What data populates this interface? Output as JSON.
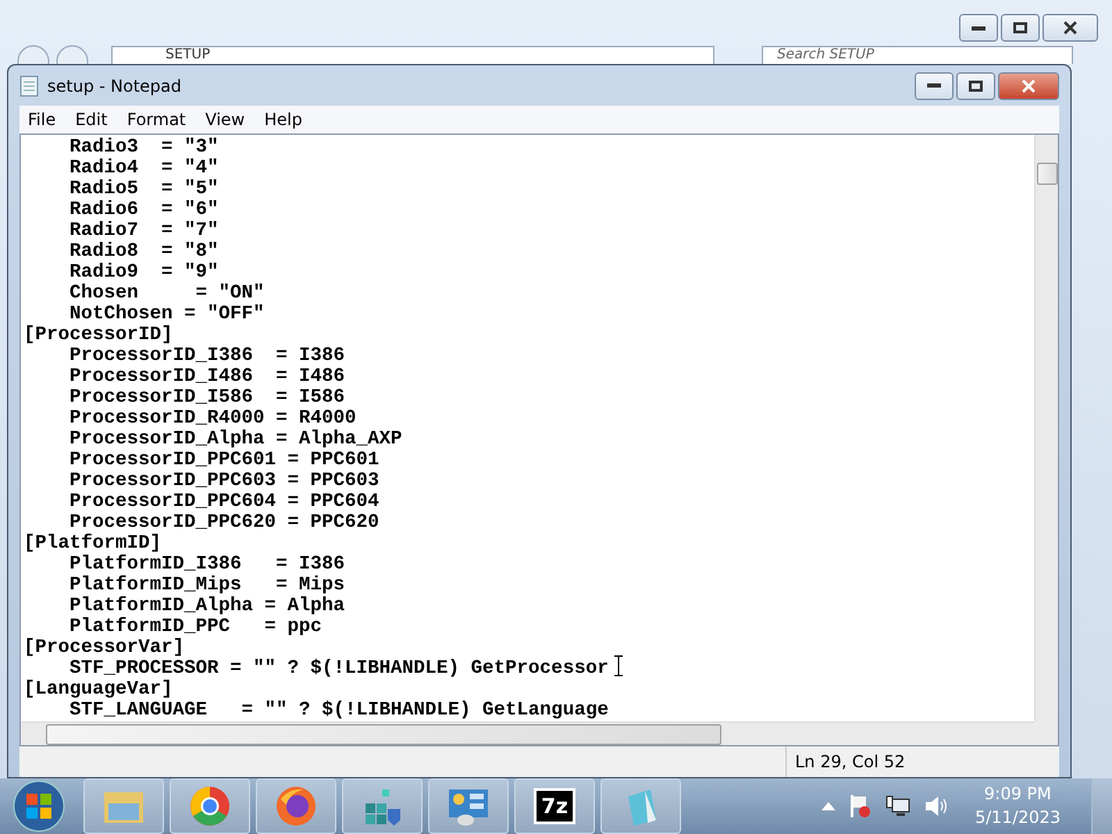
{
  "background_window": {
    "address": "SETUP",
    "search_placeholder": "Search SETUP"
  },
  "window": {
    "title": "setup - Notepad"
  },
  "menu": [
    "File",
    "Edit",
    "Format",
    "View",
    "Help"
  ],
  "lines": [
    "    Radio3  = \"3\"",
    "    Radio4  = \"4\"",
    "    Radio5  = \"5\"",
    "    Radio6  = \"6\"",
    "    Radio7  = \"7\"",
    "    Radio8  = \"8\"",
    "    Radio9  = \"9\"",
    "    Chosen     = \"ON\"",
    "    NotChosen = \"OFF\"",
    "[ProcessorID]",
    "    ProcessorID_I386  = I386",
    "    ProcessorID_I486  = I486",
    "    ProcessorID_I586  = I586",
    "    ProcessorID_R4000 = R4000",
    "    ProcessorID_Alpha = Alpha_AXP",
    "    ProcessorID_PPC601 = PPC601",
    "    ProcessorID_PPC603 = PPC603",
    "    ProcessorID_PPC604 = PPC604",
    "    ProcessorID_PPC620 = PPC620",
    "[PlatformID]",
    "    PlatformID_I386   = I386",
    "    PlatformID_Mips   = Mips",
    "    PlatformID_Alpha = Alpha",
    "    PlatformID_PPC   = ppc",
    "[ProcessorVar]",
    "    STF_PROCESSOR = \"\" ? $(!LIBHANDLE) GetProcessor",
    "[LanguageVar]",
    "    STF_LANGUAGE   = \"\" ? $(!LIBHANDLE) GetLanguage"
  ],
  "status_bar": {
    "position": "Ln 29, Col 52"
  },
  "taskbar": {
    "items": [
      {
        "kind": "start"
      },
      {
        "kind": "folder"
      },
      {
        "kind": "chrome"
      },
      {
        "kind": "firefox"
      },
      {
        "kind": "cubes"
      },
      {
        "kind": "panel"
      },
      {
        "kind": "archive",
        "label": "7z"
      },
      {
        "kind": "notepad"
      }
    ],
    "clock": {
      "time": "9:09 PM",
      "date": "5/11/2023"
    }
  }
}
